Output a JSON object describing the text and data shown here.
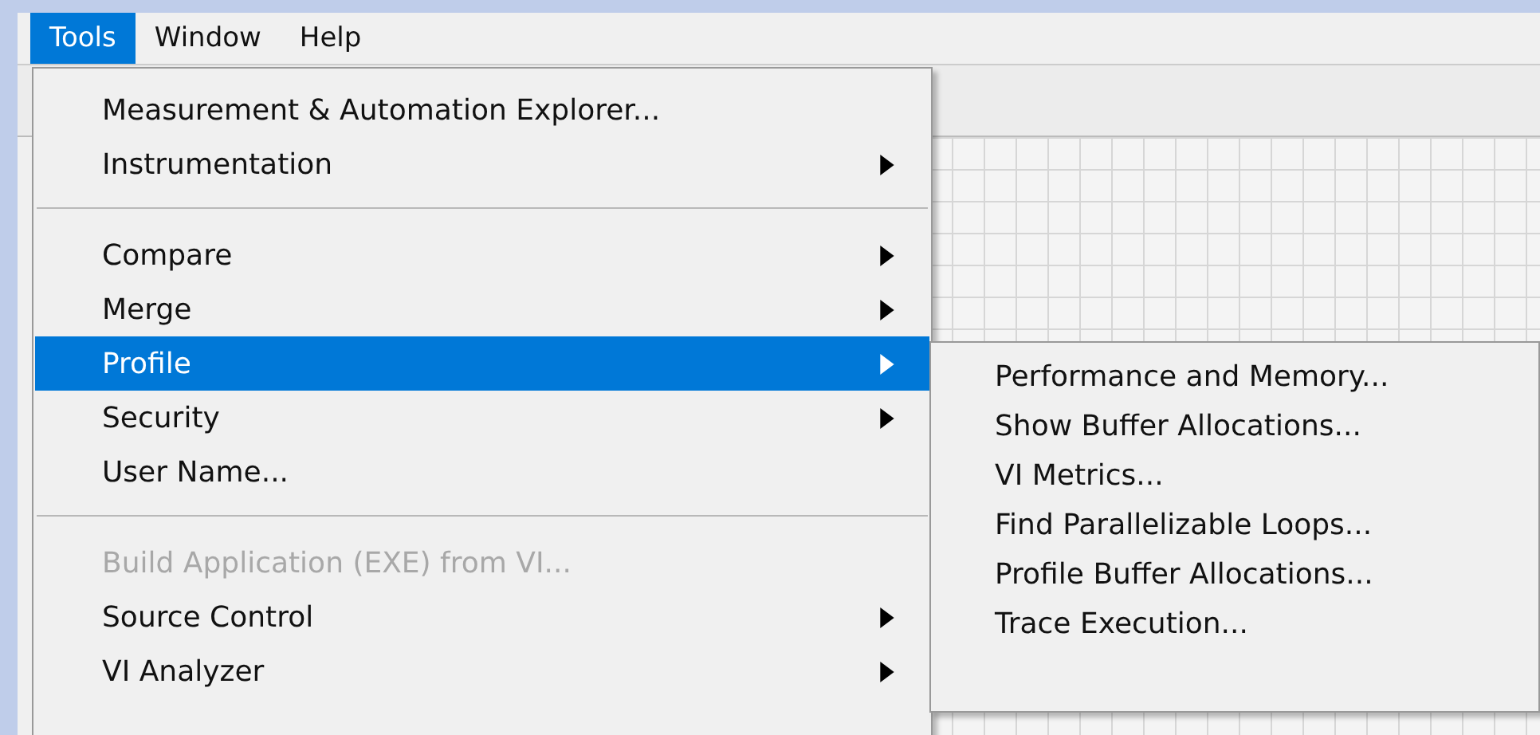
{
  "menubar": [
    {
      "label": "Tools",
      "selected": true
    },
    {
      "label": "Window",
      "selected": false
    },
    {
      "label": "Help",
      "selected": false
    }
  ],
  "menu": [
    {
      "kind": "item",
      "label": "Measurement & Automation Explorer...",
      "submenu": false,
      "disabled": false,
      "selected": false
    },
    {
      "kind": "item",
      "label": "Instrumentation",
      "submenu": true,
      "disabled": false,
      "selected": false
    },
    {
      "kind": "separator"
    },
    {
      "kind": "item",
      "label": "Compare",
      "submenu": true,
      "disabled": false,
      "selected": false
    },
    {
      "kind": "item",
      "label": "Merge",
      "submenu": true,
      "disabled": false,
      "selected": false
    },
    {
      "kind": "item",
      "label": "Profile",
      "submenu": true,
      "disabled": false,
      "selected": true
    },
    {
      "kind": "item",
      "label": "Security",
      "submenu": true,
      "disabled": false,
      "selected": false
    },
    {
      "kind": "item",
      "label": "User Name...",
      "submenu": false,
      "disabled": false,
      "selected": false
    },
    {
      "kind": "separator"
    },
    {
      "kind": "item",
      "label": "Build Application (EXE) from VI...",
      "submenu": false,
      "disabled": true,
      "selected": false
    },
    {
      "kind": "item",
      "label": "Source Control",
      "submenu": true,
      "disabled": false,
      "selected": false
    },
    {
      "kind": "item",
      "label": "VI Analyzer",
      "submenu": true,
      "disabled": false,
      "selected": false
    }
  ],
  "submenu": [
    {
      "label": "Performance and Memory...",
      "selected": false
    },
    {
      "label": "Show Buffer Allocations...",
      "selected": false
    },
    {
      "label": "VI Metrics...",
      "selected": false
    },
    {
      "label": "Find Parallelizable Loops...",
      "selected": false
    },
    {
      "label": "Profile Buffer Allocations...",
      "selected": false
    },
    {
      "label": "Trace Execution...",
      "selected": false
    }
  ]
}
